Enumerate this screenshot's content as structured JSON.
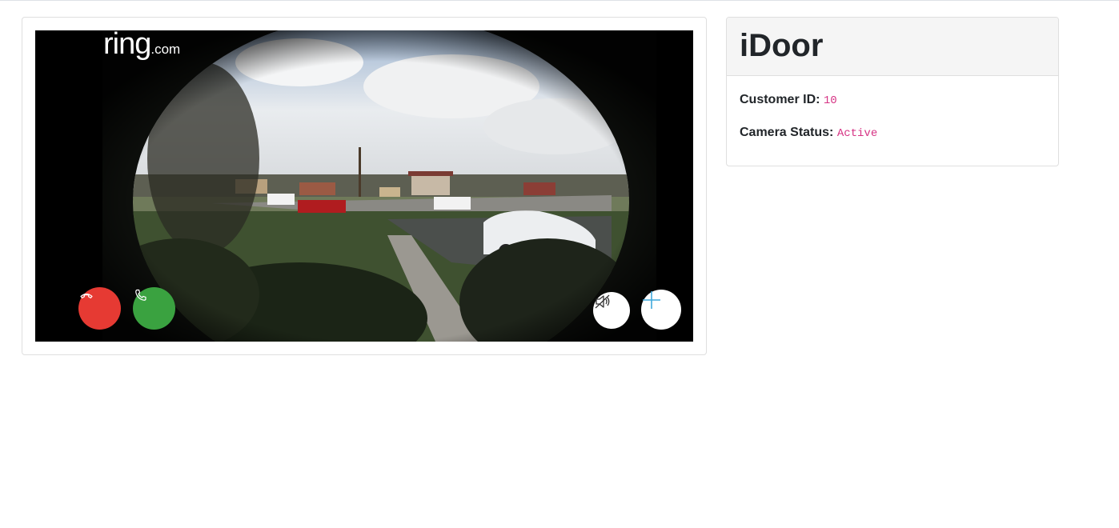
{
  "video": {
    "logo_main": "ring",
    "logo_suffix": ".com",
    "controls": {
      "decline_icon": "phone-hangup-icon",
      "accept_icon": "phone-icon",
      "mute_icon": "speaker-mute-icon",
      "add_icon": "plus-icon"
    }
  },
  "info": {
    "title": "iDoor",
    "customer_id_label": "Customer ID:",
    "customer_id_value": "10",
    "camera_status_label": "Camera Status:",
    "camera_status_value": "Active"
  },
  "colors": {
    "decline": "#e63a33",
    "accept": "#3aa240",
    "value_text": "#d63384",
    "plus_icon": "#3fa9dc"
  }
}
